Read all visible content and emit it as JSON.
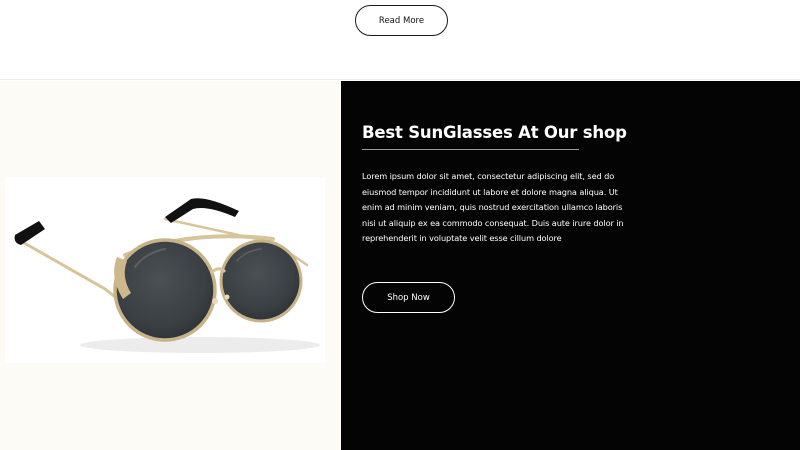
{
  "top_section": {
    "read_more_label": "Read More"
  },
  "promo": {
    "title": "Best SunGlasses At Our shop",
    "description": "Lorem ipsum dolor sit amet, consectetur adipiscing elit, sed do eiusmod tempor incididunt ut labore et dolore magna aliqua. Ut enim ad minim veniam, quis nostrud exercitation ullamco laboris nisi ut aliquip ex ea commodo consequat. Duis aute irure dolor in reprehenderit in voluptate velit esse cillum dolore",
    "shop_now_label": "Shop Now"
  },
  "product_image": {
    "subject": "round-sunglasses",
    "frame_color": "#c9b48a",
    "lens_color": "#3f4448",
    "tip_color": "#111111"
  },
  "colors": {
    "dark_panel": "#040404",
    "light_panel": "#fdfbf6",
    "text_light": "#ffffff",
    "text_dark": "#111111"
  }
}
